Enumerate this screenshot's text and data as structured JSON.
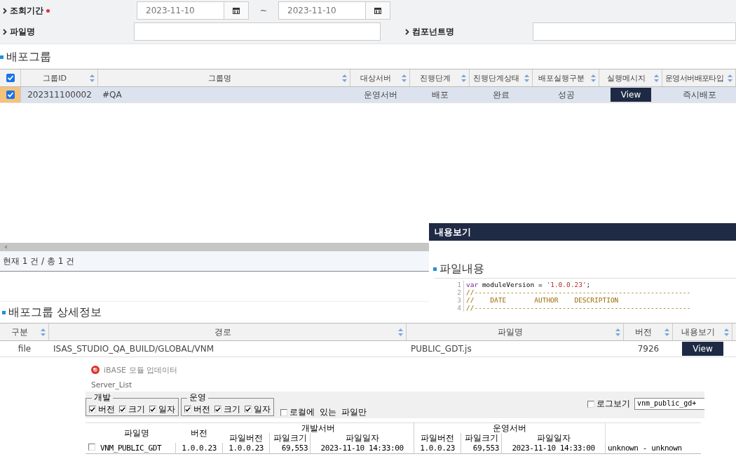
{
  "search_form": {
    "fields": [
      {
        "label": "조회기간",
        "required": true,
        "kind": "daterange",
        "from": "2023-11-10",
        "separator": "~",
        "to": "2023-11-10"
      },
      {
        "label": "파일명",
        "kind": "text"
      },
      {
        "label": "컴포넌트명",
        "kind": "text"
      }
    ]
  },
  "group_section": {
    "title": "배포그룹",
    "table": {
      "header_checked": true,
      "columns": [
        {
          "label": "그룹ID"
        },
        {
          "label": "그룹명"
        },
        {
          "label": "대상서버"
        },
        {
          "label": "진행단계"
        },
        {
          "label": "진행단계상태"
        },
        {
          "label": "배포실행구분"
        },
        {
          "label": "실행메시지"
        },
        {
          "label": "운영서버배포타입"
        }
      ],
      "rows": [
        {
          "selected": true,
          "checked": true,
          "cells": [
            {
              "kind": "text",
              "text": "202311100002"
            },
            {
              "kind": "text",
              "text": "#QA"
            },
            {
              "kind": "text",
              "text": "운영서버"
            },
            {
              "kind": "text",
              "text": "배포"
            },
            {
              "kind": "text",
              "text": "완료"
            },
            {
              "kind": "text",
              "text": "성공"
            },
            {
              "kind": "button",
              "text": "View"
            },
            {
              "kind": "text",
              "text": "즉시배포"
            }
          ]
        }
      ]
    },
    "status": "현재 1 건 / 총 1 건"
  },
  "content_view": {
    "title": "내용보기",
    "section_title": "파일내용",
    "code_lines": [
      {
        "number": "1",
        "tokens": [
          {
            "kind": "keyword",
            "text": "var"
          },
          {
            "kind": "plain",
            "text": " moduleVersion = "
          },
          {
            "kind": "string",
            "text": "'1.0.0.23'"
          },
          {
            "kind": "plain",
            "text": ";"
          }
        ]
      },
      {
        "number": "2",
        "tokens": [
          {
            "kind": "comment",
            "text": "//------------------------------------------------------"
          }
        ]
      },
      {
        "number": "3",
        "tokens": [
          {
            "kind": "comment",
            "text": "//    DATE       AUTHOR    DESCRIPTION"
          }
        ]
      },
      {
        "number": "4",
        "tokens": [
          {
            "kind": "comment",
            "text": "//------------------------------------------------------"
          }
        ]
      }
    ]
  },
  "detail_section": {
    "title": "배포그룹 상세정보",
    "table": {
      "columns": [
        {
          "label": "구분"
        },
        {
          "label": "경로"
        },
        {
          "label": "파일명"
        },
        {
          "label": "버전"
        },
        {
          "label": "내용보기"
        }
      ],
      "rows": [
        {
          "selected": false,
          "cells": [
            {
              "kind": "text",
              "text": "file"
            },
            {
              "kind": "text",
              "text": "ISAS_STUDIO_QA_BUILD/GLOBAL/VNM"
            },
            {
              "kind": "text",
              "text": "PUBLIC_GDT.js"
            },
            {
              "kind": "text",
              "text": "7926"
            },
            {
              "kind": "button",
              "text": "View"
            }
          ]
        }
      ]
    }
  },
  "updater": {
    "title": "iBASE 모듈 업데이터",
    "list_label": "Server_List",
    "groups": [
      {
        "title": "개발",
        "options": [
          {
            "label": "버전",
            "checked": true
          },
          {
            "label": "크기",
            "checked": true
          },
          {
            "label": "일자",
            "checked": true
          }
        ]
      },
      {
        "title": "운영",
        "options": [
          {
            "label": "버전",
            "checked": true
          },
          {
            "label": "크기",
            "checked": true
          },
          {
            "label": "일자",
            "checked": true
          }
        ]
      }
    ],
    "local_only": {
      "label": "로컬에 있는 파일만",
      "checked": false
    },
    "log": {
      "label": "로그보기",
      "checked": false
    },
    "log_field": {
      "value": "vnm_public_gd+"
    },
    "table": {
      "file_header": "파일명",
      "version_header": "버전",
      "server_groups": [
        {
          "title": "개발서버",
          "columns": [
            "파일버전",
            "파일크기",
            "파일일자"
          ]
        },
        {
          "title": "운영서버",
          "columns": [
            "파일버전",
            "파일크기",
            "파일일자"
          ]
        }
      ],
      "rows": [
        {
          "checked": false,
          "file": "VNM_PUBLIC_GDT",
          "version": "1.0.0.23",
          "servers": [
            [
              "1.0.0.23",
              "69,553",
              "2023-11-10 14:33:00"
            ],
            [
              "1.0.0.23",
              "69,553",
              "2023-11-10 14:33:00"
            ]
          ],
          "note": "unknown - unknown"
        }
      ]
    }
  }
}
